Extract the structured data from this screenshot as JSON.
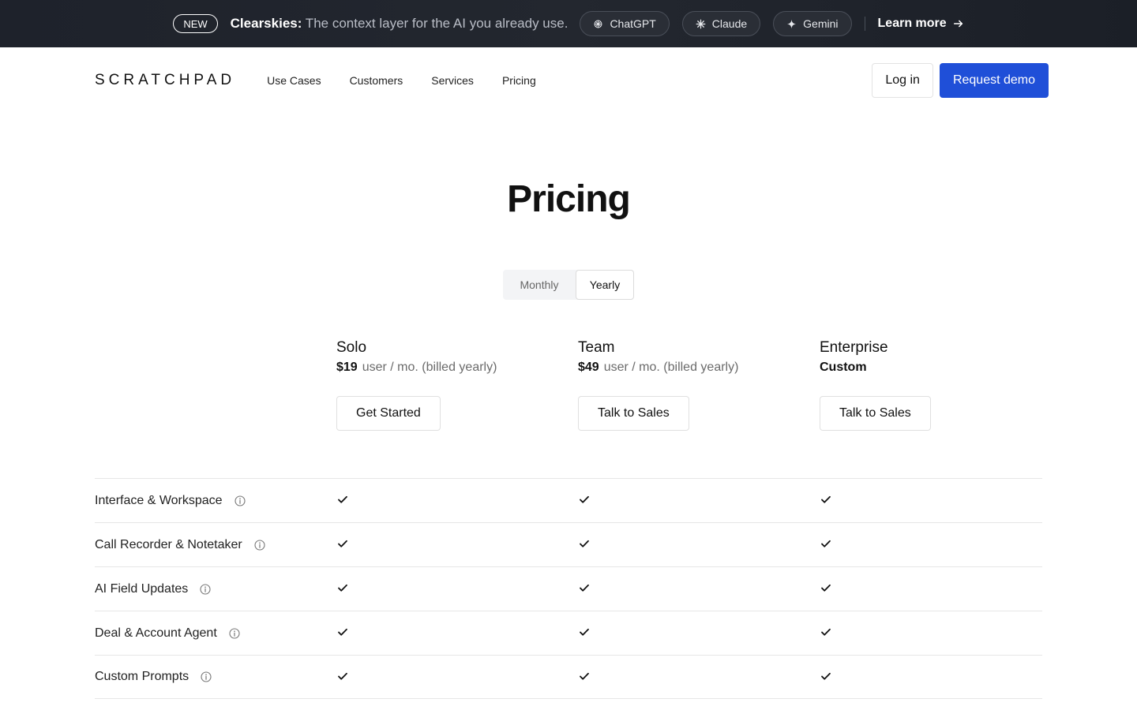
{
  "announcement": {
    "badge": "NEW",
    "brand": "Clearskies:",
    "text": " The context layer for the AI you already use.",
    "chips": [
      {
        "label": "ChatGPT",
        "icon": "openai-icon"
      },
      {
        "label": "Claude",
        "icon": "claude-icon"
      },
      {
        "label": "Gemini",
        "icon": "gemini-icon"
      }
    ],
    "learn_more": "Learn more"
  },
  "nav": {
    "logo": "SCRATCHPAD",
    "links": [
      "Use Cases",
      "Customers",
      "Services",
      "Pricing"
    ],
    "login": "Log in",
    "demo": "Request demo"
  },
  "page": {
    "title": "Pricing"
  },
  "billing_toggle": {
    "options": [
      "Monthly",
      "Yearly"
    ],
    "selected": "Yearly"
  },
  "plans": [
    {
      "name": "Solo",
      "price": "$19",
      "period": "user / mo. (billed yearly)",
      "cta": "Get Started"
    },
    {
      "name": "Team",
      "price": "$49",
      "period": "user / mo. (billed yearly)",
      "cta": "Talk to Sales"
    },
    {
      "name": "Enterprise",
      "price": "Custom",
      "period": "",
      "cta": "Talk to Sales"
    }
  ],
  "features": [
    {
      "label": "Interface & Workspace",
      "solo": true,
      "team": true,
      "enterprise": true
    },
    {
      "label": "Call Recorder & Notetaker",
      "solo": true,
      "team": true,
      "enterprise": true
    },
    {
      "label": "AI Field Updates",
      "solo": true,
      "team": true,
      "enterprise": true
    },
    {
      "label": "Deal & Account Agent",
      "solo": true,
      "team": true,
      "enterprise": true
    },
    {
      "label": "Custom Prompts",
      "solo": true,
      "team": true,
      "enterprise": true
    }
  ],
  "colors": {
    "announce_bg": "#1e222b",
    "primary": "#1f4fd8",
    "text": "#111111",
    "muted": "#6b6b6b",
    "divider": "#e6e6e6"
  }
}
